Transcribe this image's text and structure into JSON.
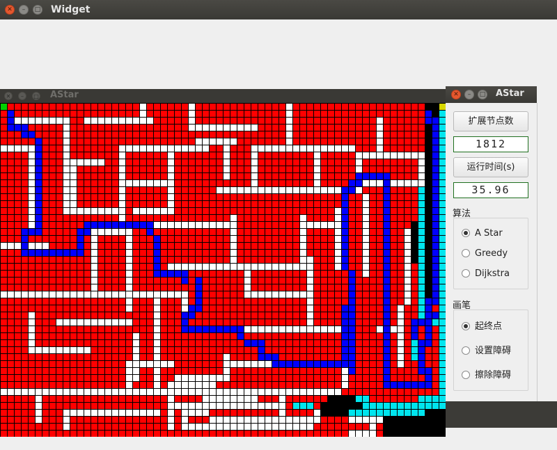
{
  "main_window": {
    "title": "Widget"
  },
  "grid_window": {
    "title": "AStar"
  },
  "panel": {
    "title": "AStar",
    "expand_button": "扩展节点数",
    "expand_value": "1812",
    "time_button": "运行时间(s)",
    "time_value": "35.96",
    "algo_label": "算法",
    "algorithms": [
      "A Star",
      "Greedy",
      "Dijkstra"
    ],
    "selected_algorithm": "A Star",
    "pen_label": "画笔",
    "pens": [
      "起终点",
      "设置障碍",
      "擦除障碍"
    ],
    "selected_pen": "起终点"
  },
  "colors": {
    "explored": "#ff0000",
    "obstacle": "#ffffff",
    "path": "#0000ff",
    "open": "#00e5ee",
    "unvisited": "#000000",
    "start": "#00d000",
    "goal": "#d8d800",
    "grid_line": "#000000"
  },
  "icons": {
    "close": "close-icon",
    "minimize": "minimize-icon",
    "maximize": "maximize-icon"
  }
}
